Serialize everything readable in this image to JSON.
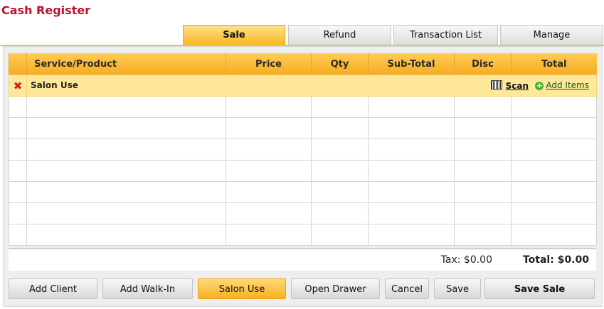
{
  "header": {
    "title": "Cash Register"
  },
  "tabs": [
    {
      "label": "Sale",
      "active": true
    },
    {
      "label": "Refund"
    },
    {
      "label": "Transaction List"
    },
    {
      "label": "Manage"
    }
  ],
  "table": {
    "columns": [
      "",
      "Service/Product",
      "Price",
      "Qty",
      "Sub-Total",
      "Disc",
      "Total"
    ],
    "group_row": {
      "label": "Salon Use",
      "scan_label": "Scan",
      "add_label": "Add Items"
    }
  },
  "totals": {
    "tax": "Tax: $0.00",
    "total": "Total: $0.00"
  },
  "buttons": {
    "add_client": "Add Client",
    "add_walkin": "Add Walk-In",
    "salon_use": "Salon Use",
    "open_drawer": "Open Drawer",
    "cancel": "Cancel",
    "save": "Save",
    "save_sale": "Save Sale"
  },
  "colors": {
    "accent": "#f8b820",
    "title": "#c0102a",
    "group_row": "#ffe89a"
  }
}
